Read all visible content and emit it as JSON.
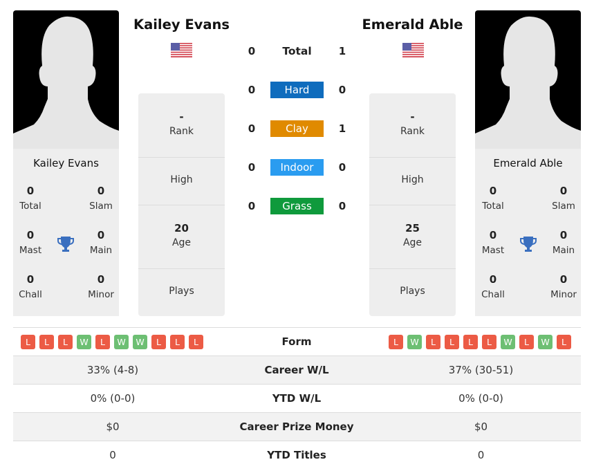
{
  "player1": {
    "name": "Kailey Evans",
    "country": "USA",
    "flag_icon": "us-flag-icon",
    "titles": {
      "total": {
        "value": "0",
        "label": "Total"
      },
      "slam": {
        "value": "0",
        "label": "Slam"
      },
      "mast": {
        "value": "0",
        "label": "Mast"
      },
      "main": {
        "value": "0",
        "label": "Main"
      },
      "chall": {
        "value": "0",
        "label": "Chall"
      },
      "minor": {
        "value": "0",
        "label": "Minor"
      }
    },
    "info": {
      "rank": {
        "value": "-",
        "label": "Rank"
      },
      "high": {
        "value": "",
        "label": "High"
      },
      "age": {
        "value": "20",
        "label": "Age"
      },
      "plays": {
        "value": "",
        "label": "Plays"
      }
    },
    "form": [
      "L",
      "L",
      "L",
      "W",
      "L",
      "W",
      "W",
      "L",
      "L",
      "L"
    ],
    "career_wl": "33% (4-8)",
    "ytd_wl": "0% (0-0)",
    "career_prize": "$0",
    "ytd_titles": "0"
  },
  "player2": {
    "name": "Emerald Able",
    "country": "USA",
    "flag_icon": "us-flag-icon",
    "titles": {
      "total": {
        "value": "0",
        "label": "Total"
      },
      "slam": {
        "value": "0",
        "label": "Slam"
      },
      "mast": {
        "value": "0",
        "label": "Mast"
      },
      "main": {
        "value": "0",
        "label": "Main"
      },
      "chall": {
        "value": "0",
        "label": "Chall"
      },
      "minor": {
        "value": "0",
        "label": "Minor"
      }
    },
    "info": {
      "rank": {
        "value": "-",
        "label": "Rank"
      },
      "high": {
        "value": "",
        "label": "High"
      },
      "age": {
        "value": "25",
        "label": "Age"
      },
      "plays": {
        "value": "",
        "label": "Plays"
      }
    },
    "form": [
      "L",
      "W",
      "L",
      "L",
      "L",
      "L",
      "W",
      "L",
      "W",
      "L"
    ],
    "career_wl": "37% (30-51)",
    "ytd_wl": "0% (0-0)",
    "career_prize": "$0",
    "ytd_titles": "0"
  },
  "h2h": {
    "total": {
      "label": "Total",
      "p1": "0",
      "p2": "1"
    },
    "surfaces": [
      {
        "label": "Hard",
        "p1": "0",
        "p2": "0",
        "color": "#0f6cbd"
      },
      {
        "label": "Clay",
        "p1": "0",
        "p2": "1",
        "color": "#e08a00"
      },
      {
        "label": "Indoor",
        "p1": "0",
        "p2": "0",
        "color": "#2a9cf0"
      },
      {
        "label": "Grass",
        "p1": "0",
        "p2": "0",
        "color": "#0f9a3c"
      }
    ]
  },
  "comparison": {
    "form_label": "Form",
    "career_wl_label": "Career W/L",
    "ytd_wl_label": "YTD W/L",
    "career_prize_label": "Career Prize Money",
    "ytd_titles_label": "YTD Titles"
  },
  "colors": {
    "loss": "#ec5b45",
    "win": "#6dbf73",
    "trophy": "#3a6fbf"
  }
}
